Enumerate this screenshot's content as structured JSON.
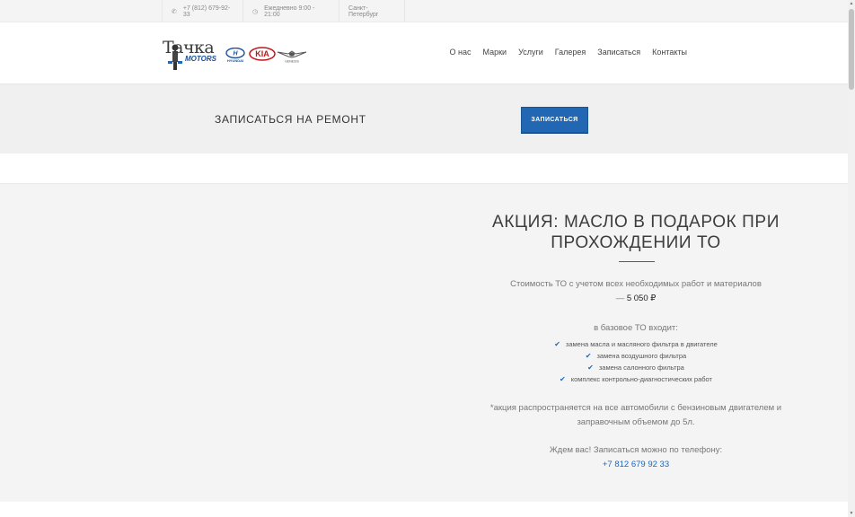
{
  "topbar": {
    "phone": "+7 (812) 679-92-33",
    "hours": "Ежедневно 9:00 - 21:00",
    "city": "Санкт-Петербург",
    "phone_icon": "phone-icon",
    "clock_icon": "clock-icon"
  },
  "logo": {
    "name": "Тачка",
    "sub": "MOTORS",
    "brands": [
      "HYUNDAI",
      "KIA",
      "GENESIS"
    ]
  },
  "nav": {
    "items": [
      "О нас",
      "Марки",
      "Услуги",
      "Галерея",
      "Записаться",
      "Контакты"
    ]
  },
  "cta": {
    "title": "ЗАПИСАТЬСЯ НА РЕМОНТ",
    "button": "ЗАПИСАТЬСЯ"
  },
  "promo": {
    "title": "АКЦИЯ: МАСЛО В ПОДАРОК ПРИ ПРОХОЖДЕНИИ ТО",
    "price_label": "Стоимость ТО с учетом всех необходимых работ и материалов",
    "price_dash": "— ",
    "price": "5 050 ₽",
    "base_label": "в базовое ТО входит:",
    "items": [
      "замена масла и масляного фильтра в двигателе",
      "замена воздушного фильтра",
      "замена салонного фильтра",
      "комплекс контрольно-диагностических работ"
    ],
    "note": "*акция распространяется на все автомобили с бензиновым двигателем и заправочным объемом до 5л.",
    "call_label": "Ждем вас! Записаться можно по телефону:",
    "phone": "+7 812 679 92 33"
  },
  "colors": {
    "accent": "#2167b4",
    "band": "#f0f0f0"
  }
}
